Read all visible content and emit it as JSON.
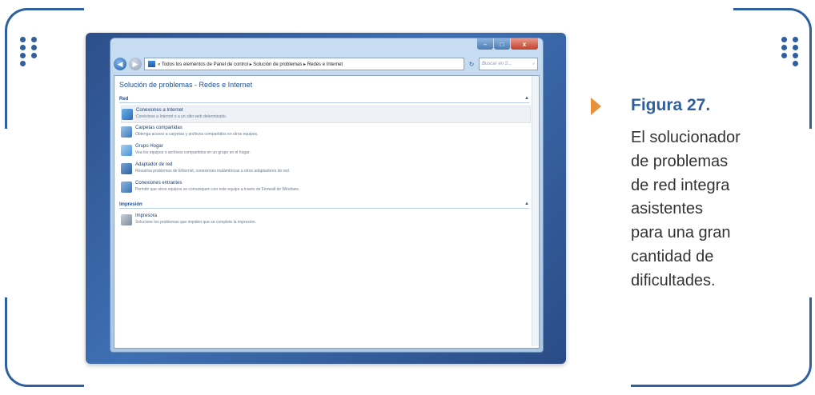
{
  "window": {
    "breadcrumb": "«  Todos los elementos de Panel de control  ▸  Solución de problemas  ▸  Redes e Internet",
    "search_placeholder": "Buscar en S...",
    "page_title": "Solución de problemas - Redes e Internet"
  },
  "sections": [
    {
      "label": "Red",
      "items": [
        {
          "title": "Conexiones a Internet",
          "desc": "Conéctese a Internet o a un sitio web determinado.",
          "icon": "internet-globe-icon",
          "color": "#3c8ad6"
        },
        {
          "title": "Carpetas compartidas",
          "desc": "Obtenga acceso a carpetas y archivos compartidos en otros equipos.",
          "icon": "shared-folder-icon",
          "color": "#4f86c6"
        },
        {
          "title": "Grupo Hogar",
          "desc": "Vea los equipos o archivos compartidos en un grupo en el hogar.",
          "icon": "homegroup-icon",
          "color": "#5ea6e0"
        },
        {
          "title": "Adaptador de red",
          "desc": "Resuelva problemas de Ethernet, conexiones inalámbricas u otros adaptadores de red.",
          "icon": "network-adapter-icon",
          "color": "#3a6fb5"
        },
        {
          "title": "Conexiones entrantes",
          "desc": "Permitir que otros equipos se comuniquen con este equipo a través de Firewall de Windows.",
          "icon": "incoming-connections-icon",
          "color": "#4a7fbf"
        }
      ]
    },
    {
      "label": "Impresión",
      "items": [
        {
          "title": "Impresora",
          "desc": "Solucione los problemas que impiden que se complete la impresión.",
          "icon": "printer-icon",
          "color": "#8c9aa8"
        }
      ]
    }
  ],
  "caption": {
    "figure": "Figura 27.",
    "lines": [
      "El solucionador",
      "de problemas",
      "de red integra",
      "asistentes",
      "para una gran",
      "cantidad de",
      "dificultades."
    ]
  },
  "colors": {
    "frame": "#2e5f9e",
    "arrow": "#e8913a",
    "window_bg": "#2c4f8a"
  }
}
